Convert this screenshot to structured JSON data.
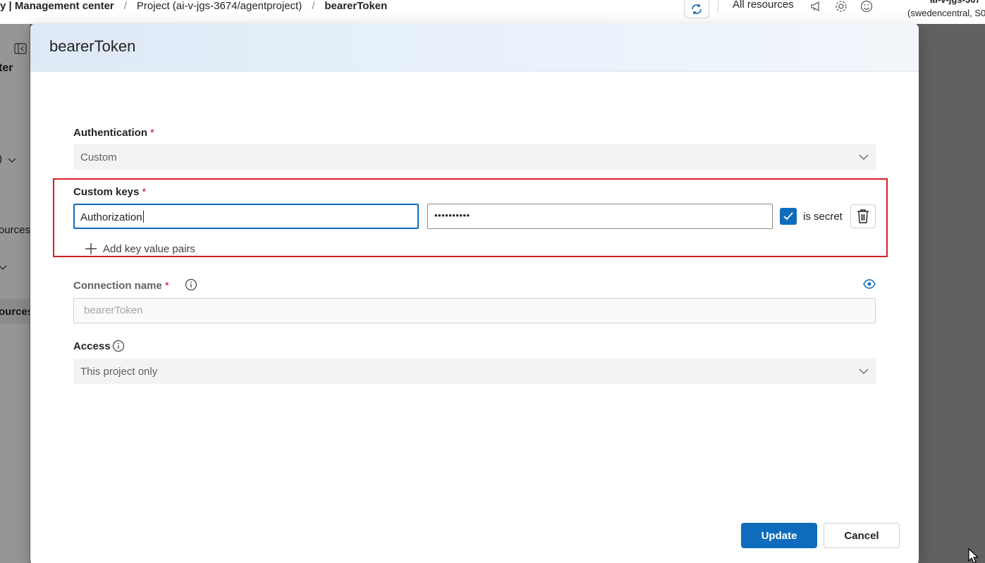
{
  "header": {
    "breadcrumb": [
      "y | Management center",
      "Project (ai-v-jgs-3674/agentproject)",
      "bearerToken"
    ],
    "breadcrumb_sep": "/",
    "all_resources": "All resources",
    "account_name": "ai-v-jgs-367",
    "account_region": "(swedencentral, S0"
  },
  "leftnav": {
    "items": [
      "ter",
      ") ",
      "ources",
      "ources"
    ]
  },
  "dialog": {
    "title": "bearerToken",
    "authentication": {
      "label": "Authentication",
      "required": "*",
      "value": "Custom"
    },
    "custom_keys": {
      "label": "Custom keys",
      "required": "*",
      "key_value": "Authorization",
      "secret_mask": "••••••••••",
      "is_secret_label": "is secret",
      "is_secret_checked": true,
      "add_pair_label": "Add key value pairs"
    },
    "connection_name": {
      "label": "Connection name",
      "required": "*",
      "placeholder": "bearerToken"
    },
    "access": {
      "label": "Access",
      "value": "This project only"
    },
    "buttons": {
      "update": "Update",
      "cancel": "Cancel"
    }
  },
  "colors": {
    "primary": "#0f6cbd",
    "required": "#c50f1f",
    "highlight": "#d42027"
  }
}
